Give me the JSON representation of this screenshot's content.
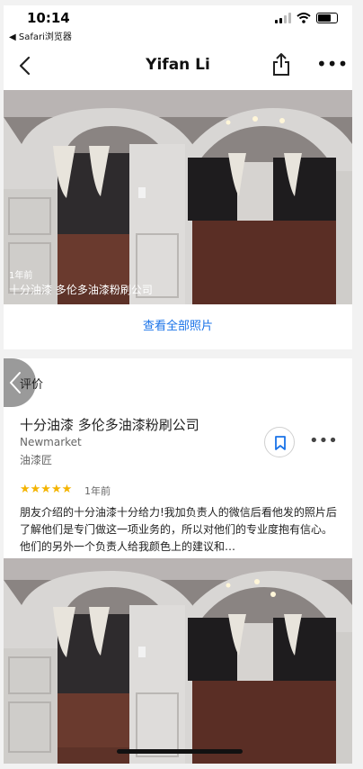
{
  "status": {
    "time": "10:14",
    "back_app": "◀ Safari浏览器"
  },
  "nav": {
    "title": "Yifan Li"
  },
  "photo": {
    "time_ago": "1年前",
    "business": "十分油漆 多伦多油漆粉刷公司"
  },
  "see_all": "查看全部照片",
  "reviews": {
    "heading": "评价",
    "business_name": "十分油漆 多伦多油漆粉刷公司",
    "location": "Newmarket",
    "category": "油漆匠",
    "rating": 5,
    "stars": "★★★★★",
    "time_ago": "1年前",
    "text": "朋友介绍的十分油漆十分给力!我加负责人的微信后看他发的照片后了解他们是专门做这一项业务的，所以对他们的专业度抱有信心。他们的另外一个负责人给我颜色上的建议和…"
  },
  "colors": {
    "link": "#1a73e8",
    "star": "#f4b400"
  }
}
